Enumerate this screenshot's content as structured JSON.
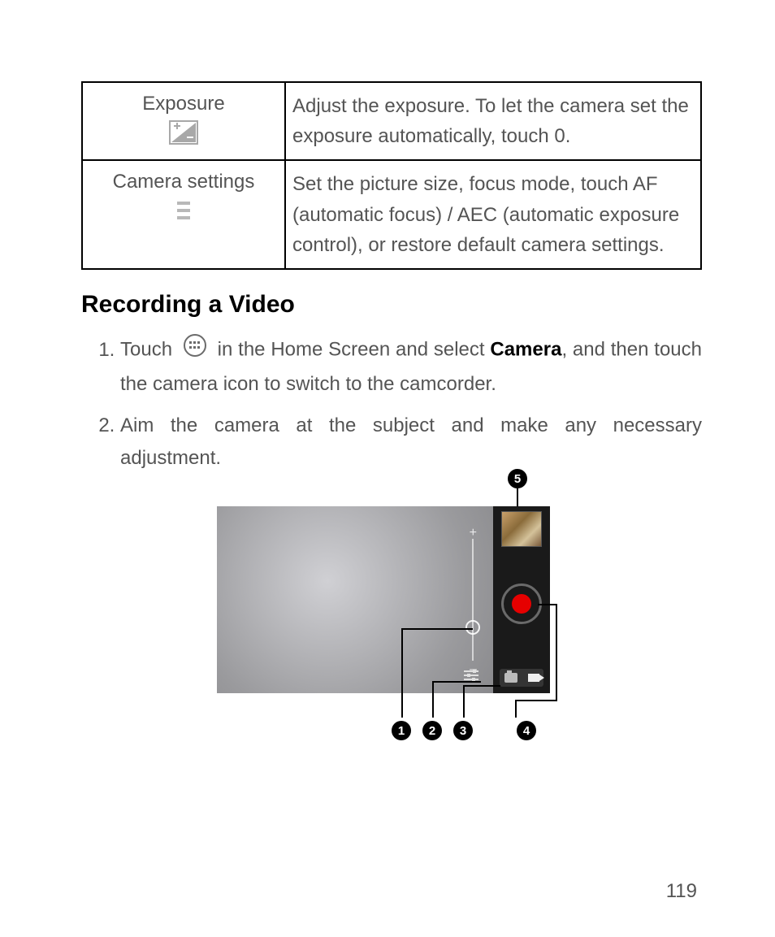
{
  "table": {
    "rows": [
      {
        "label": "Exposure",
        "desc": "Adjust the exposure. To let the camera set the exposure automatically, touch 0."
      },
      {
        "label": "Camera settings",
        "desc": "Set the picture size, focus mode, touch AF (automatic focus) / AEC (automatic exposure control), or restore default camera settings."
      }
    ]
  },
  "section_heading": "Recording a Video",
  "steps": {
    "s1a": "Touch ",
    "s1b": " in the Home Screen and select ",
    "s1_bold": "Camera",
    "s1c": ", and then touch the camera icon to switch to the camcorder.",
    "s2": "Aim the camera at the subject and make any necessary adjustment."
  },
  "callouts": {
    "c1": "1",
    "c2": "2",
    "c3": "3",
    "c4": "4",
    "c5": "5"
  },
  "page_number": "119"
}
